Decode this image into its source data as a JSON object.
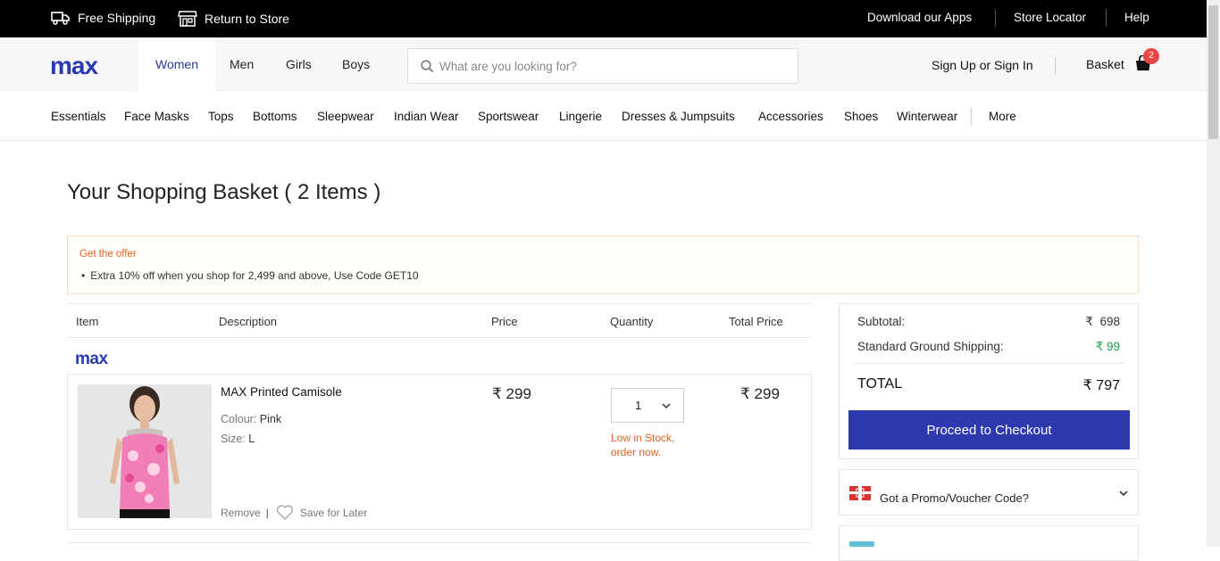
{
  "topbar": {
    "free_shipping": "Free Shipping",
    "return_to_store": "Return to Store",
    "download_apps": "Download our Apps",
    "store_locator": "Store Locator",
    "help": "Help"
  },
  "header": {
    "logo": "max",
    "genders": [
      "Women",
      "Men",
      "Girls",
      "Boys"
    ],
    "active_gender": "Women",
    "search_placeholder": "What are you looking for?",
    "sign_in": "Sign Up or Sign In",
    "basket_label": "Basket",
    "basket_count": "2"
  },
  "categories": [
    "Essentials",
    "Face Masks",
    "Tops",
    "Bottoms",
    "Sleepwear",
    "Indian Wear",
    "Sportswear",
    "Lingerie",
    "Dresses & Jumpsuits",
    "Accessories",
    "Shoes",
    "Winterwear"
  ],
  "more_label": "More",
  "page": {
    "title": "Your Shopping Basket ( 2 Items )"
  },
  "offer": {
    "heading": "Get the offer",
    "line": "Extra 10% off when you shop for 2,499 and above, Use Code GET10"
  },
  "table": {
    "headers": [
      "Item",
      "Description",
      "Price",
      "Quantity",
      "Total Price"
    ],
    "brand": "max"
  },
  "item": {
    "name": "MAX Printed Camisole",
    "colour_label": "Colour:",
    "colour": "Pink",
    "size_label": "Size:",
    "size": "L",
    "price": "₹ 299",
    "quantity": "1",
    "low_stock": "Low in Stock, order now.",
    "total_price": "₹ 299",
    "remove": "Remove",
    "save_for_later": "Save for Later"
  },
  "summary": {
    "subtotal_label": "Subtotal:",
    "subtotal_value": "₹  698",
    "shipping_label": "Standard Ground Shipping:",
    "shipping_value": "₹ 99",
    "total_label": "TOTAL",
    "total_value": "₹ 797",
    "checkout_label": "Proceed to Checkout"
  },
  "promo": {
    "label": "Got a Promo/Voucher Code?"
  },
  "colors": {
    "brand_blue": "#2d39ae",
    "offer_orange": "#e0651e",
    "shipping_green": "#1aa34a",
    "badge_red": "#e84545"
  }
}
